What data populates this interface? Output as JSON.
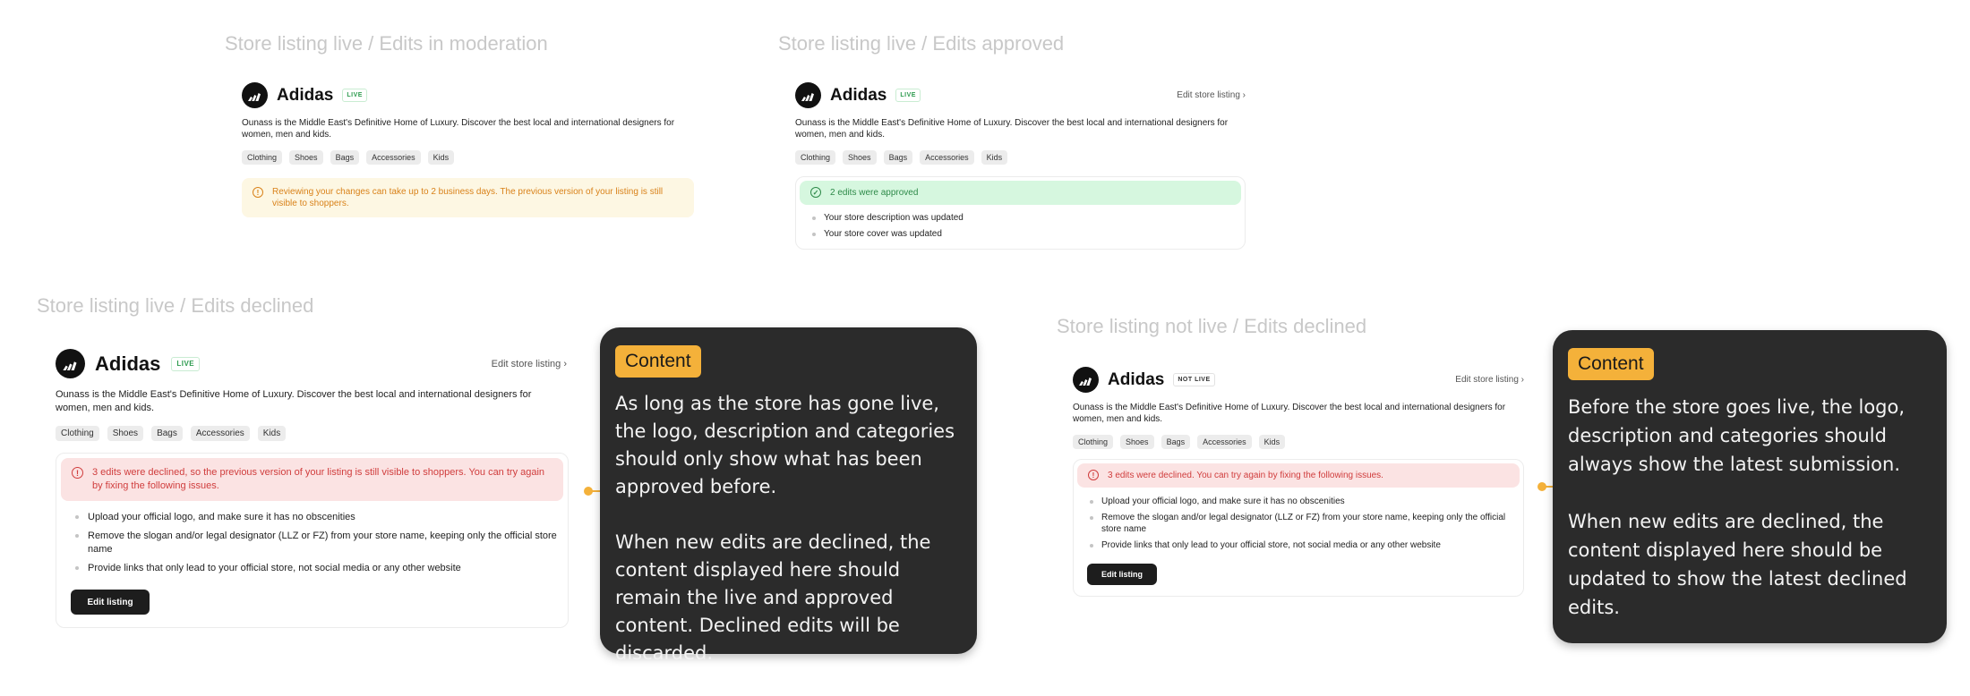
{
  "frames": [
    {
      "title": "Store listing live / Edits in moderation",
      "brand": "Adidas",
      "badge": "LIVE",
      "description": "Ounass is the Middle East's Definitive Home of Luxury. Discover the best local and international designers for women, men and kids.",
      "tags": [
        "Clothing",
        "Shoes",
        "Bags",
        "Accessories",
        "Kids"
      ],
      "alert": {
        "type": "warning",
        "text": "Reviewing your changes can take up to 2 business days. The previous version of your listing is still visible to shoppers."
      }
    },
    {
      "title": "Store listing live / Edits approved",
      "brand": "Adidas",
      "badge": "LIVE",
      "edit_link": "Edit store listing ›",
      "description": "Ounass is the Middle East's Definitive Home of Luxury. Discover the best local and international designers for women, men and kids.",
      "tags": [
        "Clothing",
        "Shoes",
        "Bags",
        "Accessories",
        "Kids"
      ],
      "alert": {
        "type": "success",
        "text": "2 edits were approved"
      },
      "items": [
        "Your store description was updated",
        "Your store cover was updated"
      ]
    },
    {
      "title": "Store listing live / Edits declined",
      "brand": "Adidas",
      "badge": "LIVE",
      "edit_link": "Edit store listing ›",
      "description": "Ounass is the Middle East's Definitive Home of Luxury. Discover the best local and international designers for women, men and kids.",
      "tags": [
        "Clothing",
        "Shoes",
        "Bags",
        "Accessories",
        "Kids"
      ],
      "alert": {
        "type": "error",
        "text": "3 edits were declined, so the previous version of your listing is still visible to shoppers. You can try again by fixing the following issues."
      },
      "items": [
        "Upload your official logo, and make sure it has no obscenities",
        "Remove the slogan and/or legal designator (LLZ or FZ) from your store name, keeping only the official store name",
        "Provide links that only lead to your official store, not social media or any other website"
      ],
      "button": "Edit listing"
    },
    {
      "title": "Store listing not live / Edits declined",
      "brand": "Adidas",
      "badge": "NOT LIVE",
      "edit_link": "Edit store listing ›",
      "description": "Ounass is the Middle East's Definitive Home of Luxury. Discover the best local and international designers for women, men and kids.",
      "tags": [
        "Clothing",
        "Shoes",
        "Bags",
        "Accessories",
        "Kids"
      ],
      "alert": {
        "type": "error",
        "text": "3 edits were declined. You can try again by fixing the following issues."
      },
      "items": [
        "Upload your official logo, and make sure it has no obscenities",
        "Remove the slogan and/or legal designator (LLZ or FZ) from your store name, keeping only the official store name",
        "Provide links that only lead to your official store, not social media or any other website"
      ],
      "button": "Edit listing"
    }
  ],
  "notes": [
    {
      "tag": "Content",
      "text": "As long as the store has gone live, the logo, description and categories should only show what has been approved before.\n\nWhen new edits are declined, the content displayed here should remain the live and approved content. Declined edits will be discarded."
    },
    {
      "tag": "Content",
      "text": "Before the store goes live, the logo, description and categories should always show the latest submission.\n\nWhen new edits are declined, the content displayed here should be updated to show the latest declined edits."
    }
  ],
  "colors": {
    "accent": "#f4b13a",
    "note_bg": "#2b2b2b",
    "live_green": "#2e9b4f",
    "error_red": "#d03d3d",
    "warning_orange": "#d9821a"
  },
  "icons": [
    "adidas-logo-icon",
    "clock-icon",
    "check-circle-icon",
    "error-circle-icon",
    "chevron-right-icon"
  ]
}
